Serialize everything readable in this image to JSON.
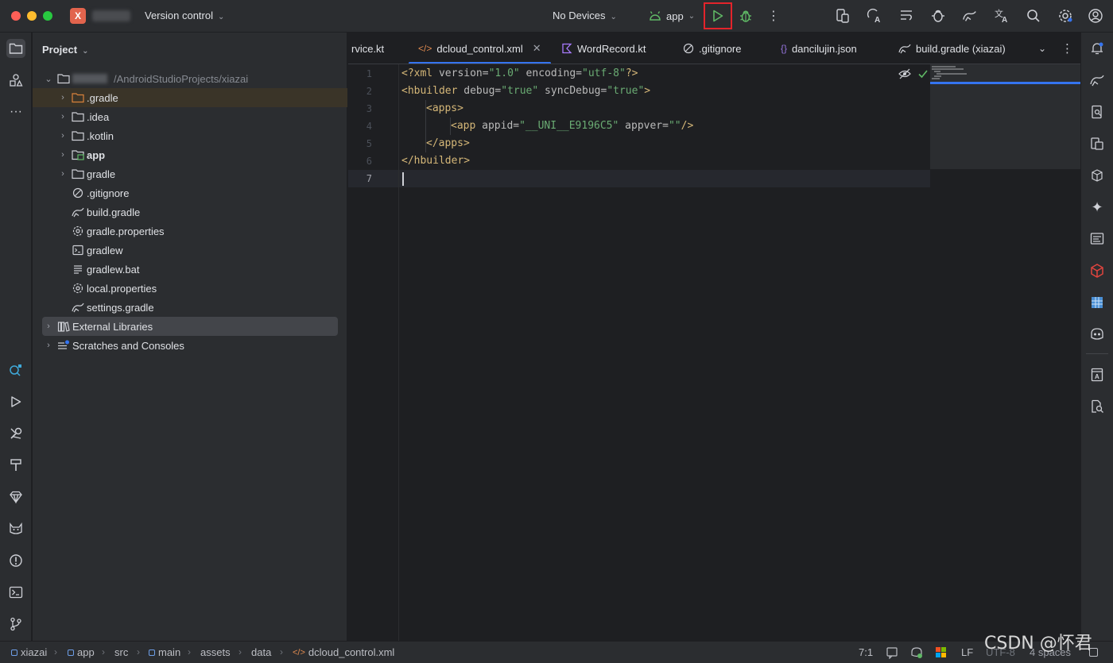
{
  "titlebar": {
    "project_badge": "X",
    "vcs_label": "Version control",
    "devices_label": "No Devices",
    "run_config": "app"
  },
  "project_panel": {
    "title": "Project",
    "root_path": "/AndroidStudioProjects/xiazai",
    "items": [
      {
        "label": ".gradle",
        "icon": "folder-orange-icon"
      },
      {
        "label": ".idea",
        "icon": "folder-icon"
      },
      {
        "label": ".kotlin",
        "icon": "folder-icon"
      },
      {
        "label": "app",
        "icon": "module-folder-icon"
      },
      {
        "label": "gradle",
        "icon": "folder-icon"
      },
      {
        "label": ".gitignore",
        "icon": "ignore-file-icon"
      },
      {
        "label": "build.gradle",
        "icon": "gradle-file-icon"
      },
      {
        "label": "gradle.properties",
        "icon": "properties-file-icon"
      },
      {
        "label": "gradlew",
        "icon": "shell-file-icon"
      },
      {
        "label": "gradlew.bat",
        "icon": "text-file-icon"
      },
      {
        "label": "local.properties",
        "icon": "properties-file-icon"
      },
      {
        "label": "settings.gradle",
        "icon": "gradle-file-icon"
      },
      {
        "label": "External Libraries",
        "icon": "library-icon"
      },
      {
        "label": "Scratches and Consoles",
        "icon": "scratches-icon"
      }
    ]
  },
  "tabs": [
    {
      "label": "rvice.kt"
    },
    {
      "label": "dcloud_control.xml",
      "active": true
    },
    {
      "label": "WordRecord.kt"
    },
    {
      "label": ".gitignore"
    },
    {
      "label": "dancilujin.json"
    },
    {
      "label": "build.gradle (xiazai)"
    }
  ],
  "editor": {
    "line_numbers": [
      "1",
      "2",
      "3",
      "4",
      "5",
      "6",
      "7"
    ],
    "lines": [
      {
        "t1": "<?xml ",
        "a1": "version=",
        "s1": "\"1.0\"",
        "a2": " encoding=",
        "s2": "\"utf-8\"",
        "t2": "?>"
      },
      {
        "t1": "<hbuilder ",
        "a1": "debug=",
        "s1": "\"true\"",
        "a2": " syncDebug=",
        "s2": "\"true\"",
        "t2": ">"
      },
      {
        "t1": "<apps>"
      },
      {
        "t1": "<app ",
        "a1": "appid=",
        "s1": "\"__UNI__E9196C5\"",
        "a2": " appver=",
        "s2": "\"\"",
        "t2": "/>"
      },
      {
        "t1": "</apps>"
      },
      {
        "t1": "</hbuilder>"
      }
    ]
  },
  "statusbar": {
    "breadcrumbs": [
      "xiazai",
      "app",
      "src",
      "main",
      "assets",
      "data",
      "dcloud_control.xml"
    ],
    "position": "7:1",
    "line_separator": "LF",
    "encoding": "UTF-8",
    "indent": "4 spaces"
  },
  "watermark": "CSDN @怀君",
  "colors": {
    "accent": "#3574f0",
    "run_highlight": "#e3242b",
    "run_green": "#5fb865"
  }
}
